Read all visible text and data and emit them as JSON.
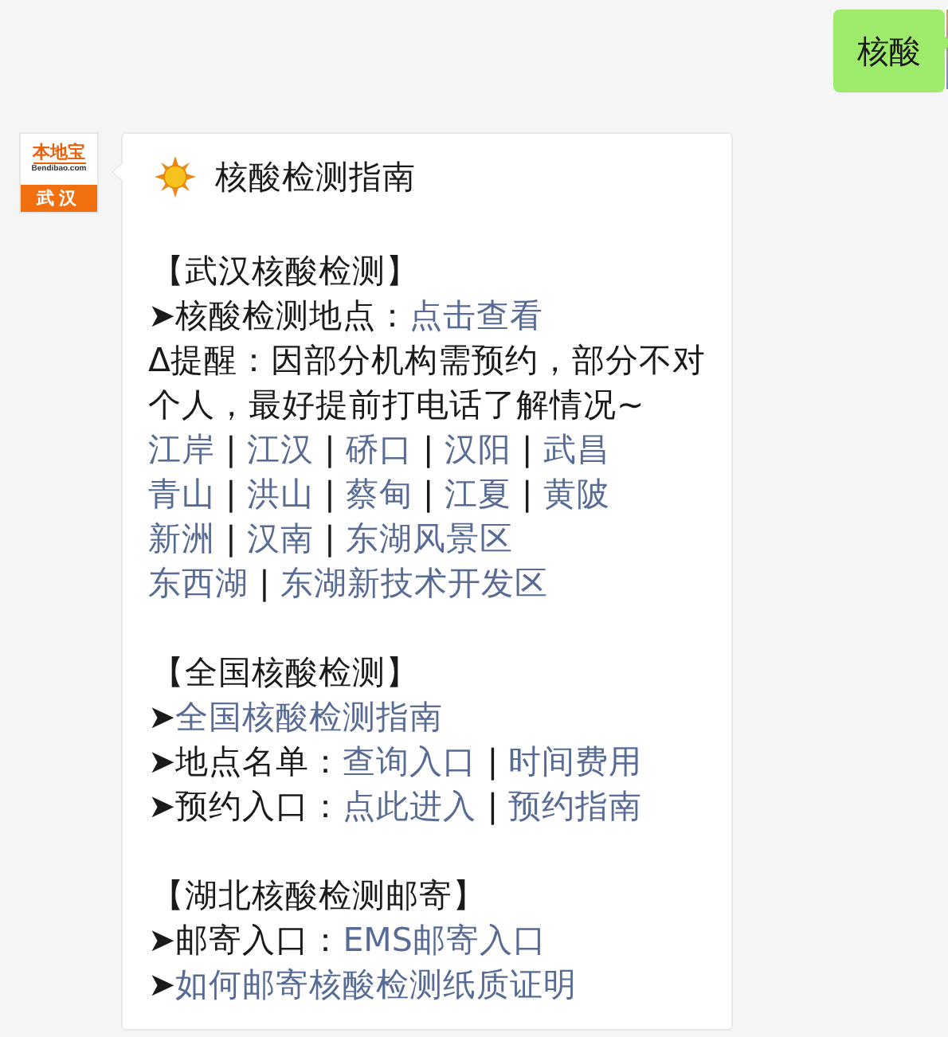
{
  "outgoing": {
    "text": "核酸"
  },
  "sender": {
    "logo_name": "本地宝",
    "logo_site": "Bendibao.com",
    "city": "武汉"
  },
  "message": {
    "title": "核酸检测指南",
    "lines": [
      {
        "kind": "blank"
      },
      {
        "kind": "heading",
        "segments": [
          {
            "kind": "plain",
            "text": "【武汉核酸检测】"
          }
        ]
      },
      {
        "kind": "text",
        "segments": [
          {
            "kind": "plain",
            "text": "➤核酸检测地点："
          },
          {
            "kind": "link",
            "text": "点击查看"
          }
        ]
      },
      {
        "kind": "text",
        "segments": [
          {
            "kind": "plain",
            "text": "Δ提醒：因部分机构需预约，部分不对个人，最好提前打电话了解情况~"
          }
        ]
      },
      {
        "kind": "text",
        "segments": [
          {
            "kind": "link",
            "text": "江岸"
          },
          {
            "kind": "plain",
            "text": " | "
          },
          {
            "kind": "link",
            "text": "江汉"
          },
          {
            "kind": "plain",
            "text": " | "
          },
          {
            "kind": "link",
            "text": "硚口"
          },
          {
            "kind": "plain",
            "text": " | "
          },
          {
            "kind": "link",
            "text": "汉阳"
          },
          {
            "kind": "plain",
            "text": " | "
          },
          {
            "kind": "link",
            "text": "武昌"
          }
        ]
      },
      {
        "kind": "text",
        "segments": [
          {
            "kind": "link",
            "text": "青山"
          },
          {
            "kind": "plain",
            "text": " | "
          },
          {
            "kind": "link",
            "text": "洪山"
          },
          {
            "kind": "plain",
            "text": " | "
          },
          {
            "kind": "link",
            "text": "蔡甸"
          },
          {
            "kind": "plain",
            "text": " | "
          },
          {
            "kind": "link",
            "text": "江夏"
          },
          {
            "kind": "plain",
            "text": " | "
          },
          {
            "kind": "link",
            "text": "黄陂"
          }
        ]
      },
      {
        "kind": "text",
        "segments": [
          {
            "kind": "link",
            "text": "新洲"
          },
          {
            "kind": "plain",
            "text": " | "
          },
          {
            "kind": "link",
            "text": "汉南"
          },
          {
            "kind": "plain",
            "text": " | "
          },
          {
            "kind": "link",
            "text": "东湖风景区"
          }
        ]
      },
      {
        "kind": "text",
        "segments": [
          {
            "kind": "link",
            "text": "东西湖"
          },
          {
            "kind": "plain",
            "text": " | "
          },
          {
            "kind": "link",
            "text": "东湖新技术开发区"
          }
        ]
      },
      {
        "kind": "blank"
      },
      {
        "kind": "heading",
        "segments": [
          {
            "kind": "plain",
            "text": "【全国核酸检测】"
          }
        ]
      },
      {
        "kind": "text",
        "segments": [
          {
            "kind": "plain",
            "text": "➤"
          },
          {
            "kind": "link",
            "text": "全国核酸检测指南"
          }
        ]
      },
      {
        "kind": "text",
        "segments": [
          {
            "kind": "plain",
            "text": "➤地点名单："
          },
          {
            "kind": "link",
            "text": "查询入口"
          },
          {
            "kind": "plain",
            "text": " | "
          },
          {
            "kind": "link",
            "text": "时间费用"
          }
        ]
      },
      {
        "kind": "text",
        "segments": [
          {
            "kind": "plain",
            "text": "➤预约入口："
          },
          {
            "kind": "link",
            "text": "点此进入"
          },
          {
            "kind": "plain",
            "text": " | "
          },
          {
            "kind": "link",
            "text": "预约指南"
          }
        ]
      },
      {
        "kind": "blank"
      },
      {
        "kind": "heading",
        "segments": [
          {
            "kind": "plain",
            "text": "【湖北核酸检测邮寄】"
          }
        ]
      },
      {
        "kind": "text",
        "segments": [
          {
            "kind": "plain",
            "text": "➤邮寄入口："
          },
          {
            "kind": "link",
            "text": "EMS邮寄入口"
          }
        ]
      },
      {
        "kind": "text",
        "segments": [
          {
            "kind": "plain",
            "text": "➤"
          },
          {
            "kind": "link",
            "text": "如何邮寄核酸检测纸质证明"
          }
        ]
      }
    ]
  }
}
